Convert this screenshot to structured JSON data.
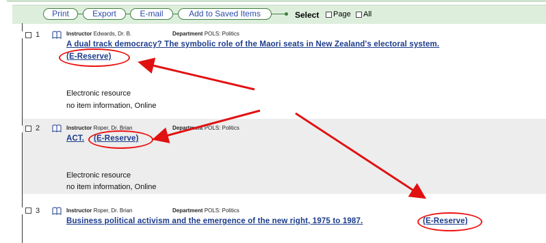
{
  "toolbar": {
    "buttons": [
      "Print",
      "Export",
      "E-mail",
      "Add to Saved Items"
    ],
    "select_label": "Select",
    "page_label": "Page",
    "all_label": "All"
  },
  "records": [
    {
      "number": "1",
      "instructor_label": "Instructor",
      "instructor": "Edwards, Dr. B.",
      "department_label": "Department",
      "department": "POLS: Politics",
      "title": "A dual track democracy? The symbolic role of the Maori seats in New Zealand's electoral system.",
      "ereserve": "(E-Reserve)",
      "resource_type": "Electronic resource",
      "availability": "no item information, Online"
    },
    {
      "number": "2",
      "instructor_label": "Instructor",
      "instructor": "Roper, Dr. Brian",
      "department_label": "Department",
      "department": "POLS: Politics",
      "title": "ACT.",
      "ereserve": "(E-Reserve)",
      "resource_type": "Electronic resource",
      "availability": "no item information, Online"
    },
    {
      "number": "3",
      "instructor_label": "Instructor",
      "instructor": "Roper, Dr. Brian",
      "department_label": "Department",
      "department": "POLS: Politics",
      "title": "Business political activism and the emergence of the new right, 1975 to 1987.",
      "ereserve": "(E-Reserve)"
    }
  ],
  "annotation_color": "#e11111"
}
